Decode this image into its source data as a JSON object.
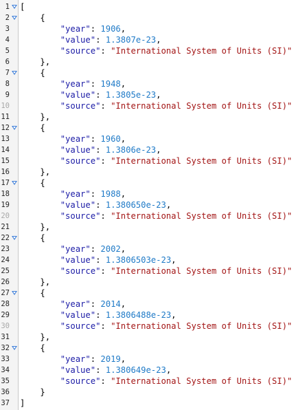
{
  "editor": {
    "lines": [
      {
        "n": "1",
        "fold": true,
        "faded": false,
        "indent": "",
        "parts": [
          {
            "t": "[",
            "c": "p"
          }
        ]
      },
      {
        "n": "2",
        "fold": true,
        "faded": false,
        "indent": "    ",
        "parts": [
          {
            "t": "{",
            "c": "p"
          }
        ]
      },
      {
        "n": "3",
        "fold": false,
        "faded": false,
        "indent": "        ",
        "parts": [
          {
            "t": "\"year\"",
            "c": "k"
          },
          {
            "t": ": ",
            "c": "p"
          },
          {
            "t": "1906",
            "c": "num"
          },
          {
            "t": ",",
            "c": "p"
          }
        ]
      },
      {
        "n": "4",
        "fold": false,
        "faded": false,
        "indent": "        ",
        "parts": [
          {
            "t": "\"value\"",
            "c": "k"
          },
          {
            "t": ": ",
            "c": "p"
          },
          {
            "t": "1.3807e-23",
            "c": "num"
          },
          {
            "t": ",",
            "c": "p"
          }
        ]
      },
      {
        "n": "5",
        "fold": false,
        "faded": false,
        "indent": "        ",
        "parts": [
          {
            "t": "\"source\"",
            "c": "k"
          },
          {
            "t": ": ",
            "c": "p"
          },
          {
            "t": "\"International System of Units (SI)\"",
            "c": "str"
          }
        ]
      },
      {
        "n": "6",
        "fold": false,
        "faded": false,
        "indent": "    ",
        "parts": [
          {
            "t": "},",
            "c": "p"
          }
        ]
      },
      {
        "n": "7",
        "fold": true,
        "faded": false,
        "indent": "    ",
        "parts": [
          {
            "t": "{",
            "c": "p"
          }
        ]
      },
      {
        "n": "8",
        "fold": false,
        "faded": false,
        "indent": "        ",
        "parts": [
          {
            "t": "\"year\"",
            "c": "k"
          },
          {
            "t": ": ",
            "c": "p"
          },
          {
            "t": "1948",
            "c": "num"
          },
          {
            "t": ",",
            "c": "p"
          }
        ]
      },
      {
        "n": "9",
        "fold": false,
        "faded": false,
        "indent": "        ",
        "parts": [
          {
            "t": "\"value\"",
            "c": "k"
          },
          {
            "t": ": ",
            "c": "p"
          },
          {
            "t": "1.3805e-23",
            "c": "num"
          },
          {
            "t": ",",
            "c": "p"
          }
        ]
      },
      {
        "n": "10",
        "fold": false,
        "faded": true,
        "indent": "        ",
        "parts": [
          {
            "t": "\"source\"",
            "c": "k"
          },
          {
            "t": ": ",
            "c": "p"
          },
          {
            "t": "\"International System of Units (SI)\"",
            "c": "str"
          }
        ]
      },
      {
        "n": "11",
        "fold": false,
        "faded": false,
        "indent": "    ",
        "parts": [
          {
            "t": "},",
            "c": "p"
          }
        ]
      },
      {
        "n": "12",
        "fold": true,
        "faded": false,
        "indent": "    ",
        "parts": [
          {
            "t": "{",
            "c": "p"
          }
        ]
      },
      {
        "n": "13",
        "fold": false,
        "faded": false,
        "indent": "        ",
        "parts": [
          {
            "t": "\"year\"",
            "c": "k"
          },
          {
            "t": ": ",
            "c": "p"
          },
          {
            "t": "1960",
            "c": "num"
          },
          {
            "t": ",",
            "c": "p"
          }
        ]
      },
      {
        "n": "14",
        "fold": false,
        "faded": false,
        "indent": "        ",
        "parts": [
          {
            "t": "\"value\"",
            "c": "k"
          },
          {
            "t": ": ",
            "c": "p"
          },
          {
            "t": "1.3806e-23",
            "c": "num"
          },
          {
            "t": ",",
            "c": "p"
          }
        ]
      },
      {
        "n": "15",
        "fold": false,
        "faded": false,
        "indent": "        ",
        "parts": [
          {
            "t": "\"source\"",
            "c": "k"
          },
          {
            "t": ": ",
            "c": "p"
          },
          {
            "t": "\"International System of Units (SI)\"",
            "c": "str"
          }
        ]
      },
      {
        "n": "16",
        "fold": false,
        "faded": false,
        "indent": "    ",
        "parts": [
          {
            "t": "},",
            "c": "p"
          }
        ]
      },
      {
        "n": "17",
        "fold": true,
        "faded": false,
        "indent": "    ",
        "parts": [
          {
            "t": "{",
            "c": "p"
          }
        ]
      },
      {
        "n": "18",
        "fold": false,
        "faded": false,
        "indent": "        ",
        "parts": [
          {
            "t": "\"year\"",
            "c": "k"
          },
          {
            "t": ": ",
            "c": "p"
          },
          {
            "t": "1988",
            "c": "num"
          },
          {
            "t": ",",
            "c": "p"
          }
        ]
      },
      {
        "n": "19",
        "fold": false,
        "faded": false,
        "indent": "        ",
        "parts": [
          {
            "t": "\"value\"",
            "c": "k"
          },
          {
            "t": ": ",
            "c": "p"
          },
          {
            "t": "1.380650e-23",
            "c": "num"
          },
          {
            "t": ",",
            "c": "p"
          }
        ]
      },
      {
        "n": "20",
        "fold": false,
        "faded": true,
        "indent": "        ",
        "parts": [
          {
            "t": "\"source\"",
            "c": "k"
          },
          {
            "t": ": ",
            "c": "p"
          },
          {
            "t": "\"International System of Units (SI)\"",
            "c": "str"
          }
        ]
      },
      {
        "n": "21",
        "fold": false,
        "faded": false,
        "indent": "    ",
        "parts": [
          {
            "t": "},",
            "c": "p"
          }
        ]
      },
      {
        "n": "22",
        "fold": true,
        "faded": false,
        "indent": "    ",
        "parts": [
          {
            "t": "{",
            "c": "p"
          }
        ]
      },
      {
        "n": "23",
        "fold": false,
        "faded": false,
        "indent": "        ",
        "parts": [
          {
            "t": "\"year\"",
            "c": "k"
          },
          {
            "t": ": ",
            "c": "p"
          },
          {
            "t": "2002",
            "c": "num"
          },
          {
            "t": ",",
            "c": "p"
          }
        ]
      },
      {
        "n": "24",
        "fold": false,
        "faded": false,
        "indent": "        ",
        "parts": [
          {
            "t": "\"value\"",
            "c": "k"
          },
          {
            "t": ": ",
            "c": "p"
          },
          {
            "t": "1.3806503e-23",
            "c": "num"
          },
          {
            "t": ",",
            "c": "p"
          }
        ]
      },
      {
        "n": "25",
        "fold": false,
        "faded": false,
        "indent": "        ",
        "parts": [
          {
            "t": "\"source\"",
            "c": "k"
          },
          {
            "t": ": ",
            "c": "p"
          },
          {
            "t": "\"International System of Units (SI)\"",
            "c": "str"
          }
        ]
      },
      {
        "n": "26",
        "fold": false,
        "faded": false,
        "indent": "    ",
        "parts": [
          {
            "t": "},",
            "c": "p"
          }
        ]
      },
      {
        "n": "27",
        "fold": true,
        "faded": false,
        "indent": "    ",
        "parts": [
          {
            "t": "{",
            "c": "p"
          }
        ]
      },
      {
        "n": "28",
        "fold": false,
        "faded": false,
        "indent": "        ",
        "parts": [
          {
            "t": "\"year\"",
            "c": "k"
          },
          {
            "t": ": ",
            "c": "p"
          },
          {
            "t": "2014",
            "c": "num"
          },
          {
            "t": ",",
            "c": "p"
          }
        ]
      },
      {
        "n": "29",
        "fold": false,
        "faded": false,
        "indent": "        ",
        "parts": [
          {
            "t": "\"value\"",
            "c": "k"
          },
          {
            "t": ": ",
            "c": "p"
          },
          {
            "t": "1.3806488e-23",
            "c": "num"
          },
          {
            "t": ",",
            "c": "p"
          }
        ]
      },
      {
        "n": "30",
        "fold": false,
        "faded": true,
        "indent": "        ",
        "parts": [
          {
            "t": "\"source\"",
            "c": "k"
          },
          {
            "t": ": ",
            "c": "p"
          },
          {
            "t": "\"International System of Units (SI)\"",
            "c": "str"
          }
        ]
      },
      {
        "n": "31",
        "fold": false,
        "faded": false,
        "indent": "    ",
        "parts": [
          {
            "t": "},",
            "c": "p"
          }
        ]
      },
      {
        "n": "32",
        "fold": true,
        "faded": false,
        "indent": "    ",
        "parts": [
          {
            "t": "{",
            "c": "p"
          }
        ]
      },
      {
        "n": "33",
        "fold": false,
        "faded": false,
        "indent": "        ",
        "parts": [
          {
            "t": "\"year\"",
            "c": "k"
          },
          {
            "t": ": ",
            "c": "p"
          },
          {
            "t": "2019",
            "c": "num"
          },
          {
            "t": ",",
            "c": "p"
          }
        ]
      },
      {
        "n": "34",
        "fold": false,
        "faded": false,
        "indent": "        ",
        "parts": [
          {
            "t": "\"value\"",
            "c": "k"
          },
          {
            "t": ": ",
            "c": "p"
          },
          {
            "t": "1.380649e-23",
            "c": "num"
          },
          {
            "t": ",",
            "c": "p"
          }
        ]
      },
      {
        "n": "35",
        "fold": false,
        "faded": false,
        "indent": "        ",
        "parts": [
          {
            "t": "\"source\"",
            "c": "k"
          },
          {
            "t": ": ",
            "c": "p"
          },
          {
            "t": "\"International System of Units (SI)\"",
            "c": "str"
          }
        ]
      },
      {
        "n": "36",
        "fold": false,
        "faded": false,
        "indent": "    ",
        "parts": [
          {
            "t": "}",
            "c": "p"
          }
        ]
      },
      {
        "n": "37",
        "fold": false,
        "faded": false,
        "indent": "",
        "parts": [
          {
            "t": "]",
            "c": "p"
          }
        ]
      }
    ],
    "colors": {
      "key": "#1a1aa6",
      "number": "#1f7ac7",
      "string": "#a31515",
      "punct": "#000000",
      "gutter_bg": "#f4f4f4",
      "fold_arrow": "#3f7fd9"
    },
    "icons": {
      "fold": "fold-arrow-icon"
    }
  }
}
